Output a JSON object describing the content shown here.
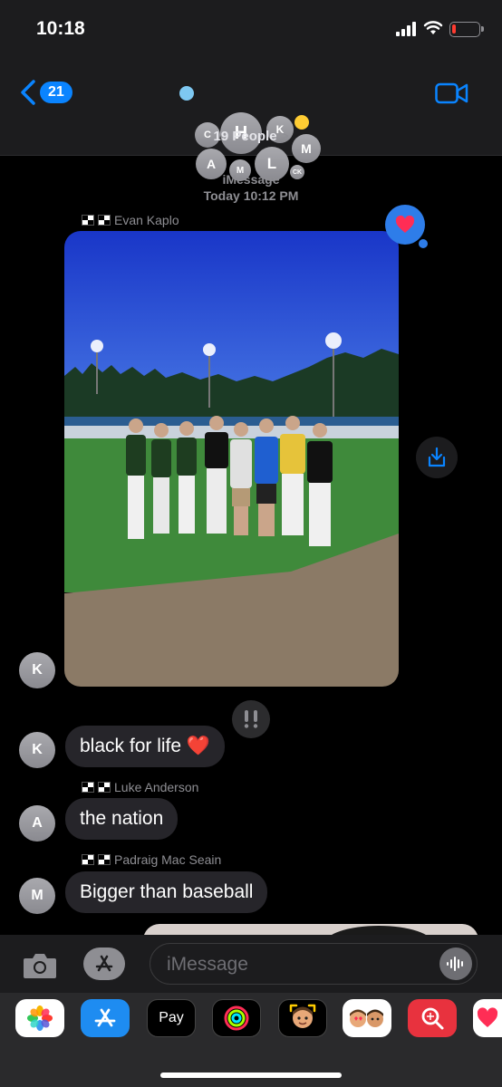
{
  "status": {
    "time": "10:18"
  },
  "header": {
    "back_count": "21",
    "people": "19 People",
    "chevron": ">",
    "avatars": [
      {
        "letter": "H"
      },
      {
        "letter": "C"
      },
      {
        "letter": "K"
      },
      {
        "letter": "A"
      },
      {
        "letter": "M"
      },
      {
        "letter": "L"
      },
      {
        "letter": "M"
      },
      {
        "letter": "CK"
      }
    ]
  },
  "conversation": {
    "service": "iMessage",
    "timestamp": "Today 10:12 PM",
    "messages": [
      {
        "sender": "Evan Kaplo",
        "avatar": "K",
        "type": "photo",
        "tapback": "heart-icon"
      },
      {
        "sender": "",
        "avatar": "K",
        "text": "black for life ❤️",
        "tapback": "double-exclamation-icon"
      },
      {
        "sender": "Luke Anderson",
        "avatar": "A",
        "text": "the nation"
      },
      {
        "sender": "Padraig Mac Seain",
        "avatar": "M",
        "text": "Bigger than baseball"
      }
    ]
  },
  "input": {
    "placeholder": "iMessage"
  },
  "apps": [
    {
      "name": "photos-icon"
    },
    {
      "name": "app-store-icon"
    },
    {
      "name": "apple-pay-icon",
      "label": "Pay"
    },
    {
      "name": "activity-icon"
    },
    {
      "name": "memoji-icon"
    },
    {
      "name": "memoji-stickers-icon"
    },
    {
      "name": "search-images-icon"
    },
    {
      "name": "digital-touch-icon"
    }
  ],
  "colors": {
    "accent": "#0a84ff",
    "bubble": "#26252a",
    "heart": "#ff2d55"
  }
}
